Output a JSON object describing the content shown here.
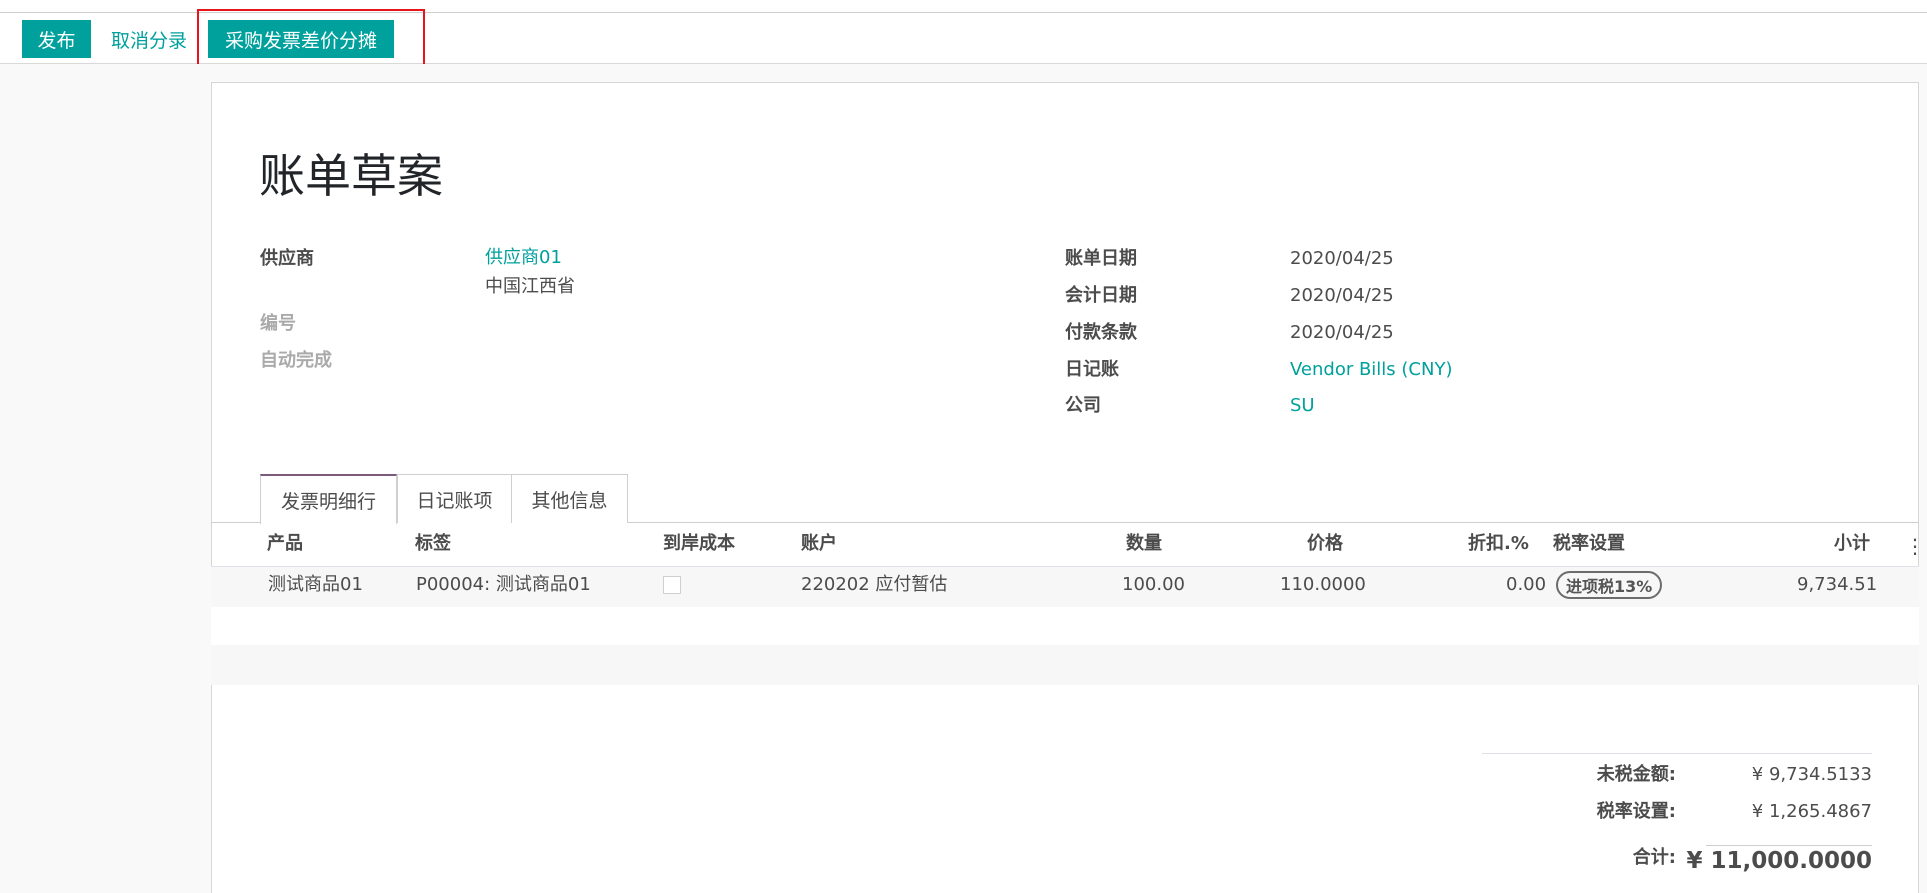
{
  "toolbar": {
    "post_label": "发布",
    "cancel_label": "取消分录",
    "allocate_label": "采购发票差价分摊"
  },
  "bill": {
    "title": "账单草案",
    "vendor_label": "供应商",
    "vendor_name": "供应商01",
    "vendor_address": "中国江西省",
    "reference_label": "编号",
    "autocomplete_label": "自动完成",
    "bill_date_label": "账单日期",
    "bill_date": "2020/04/25",
    "accounting_date_label": "会计日期",
    "accounting_date": "2020/04/25",
    "payment_terms_label": "付款条款",
    "payment_terms": "2020/04/25",
    "journal_label": "日记账",
    "journal": "Vendor Bills (CNY)",
    "company_label": "公司",
    "company": "SU"
  },
  "tabs": [
    {
      "label": "发票明细行",
      "active": true
    },
    {
      "label": "日记账项",
      "active": false
    },
    {
      "label": "其他信息",
      "active": false
    }
  ],
  "table": {
    "headers": {
      "product": "产品",
      "label": "标签",
      "landed_cost": "到岸成本",
      "account": "账户",
      "quantity": "数量",
      "price": "价格",
      "discount": "折扣.%",
      "taxes": "税率设置",
      "subtotal": "小计"
    },
    "rows": [
      {
        "product": "测试商品01",
        "label": "P00004: 测试商品01",
        "landed_cost": false,
        "account": "220202 应付暂估",
        "quantity": "100.00",
        "price": "110.0000",
        "discount": "0.00",
        "tax": "进项税13%",
        "subtotal": "9,734.51"
      }
    ]
  },
  "totals": {
    "untaxed_label": "未税金额:",
    "untaxed_value": "¥ 9,734.5133",
    "tax_label": "税率设置:",
    "tax_value": "¥ 1,265.4867",
    "total_label": "合计:",
    "total_value": "¥ 11,000.0000"
  },
  "colors": {
    "primary": "#00a09d",
    "highlight": "#e8141b",
    "tab_accent": "#7c5a7b"
  }
}
